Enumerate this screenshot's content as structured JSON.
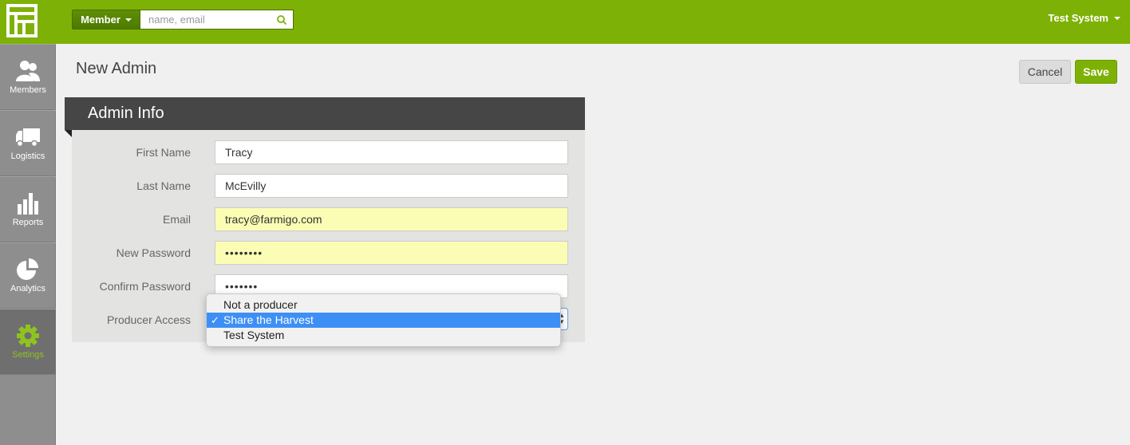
{
  "header": {
    "search_scope": "Member",
    "search_placeholder": "name, email",
    "search_value": "",
    "account_name": "Test System"
  },
  "sidebar": {
    "items": [
      {
        "label": "Members",
        "icon": "members-icon"
      },
      {
        "label": "Logistics",
        "icon": "truck-icon"
      },
      {
        "label": "Reports",
        "icon": "bar-chart-icon"
      },
      {
        "label": "Analytics",
        "icon": "pie-chart-icon"
      },
      {
        "label": "Settings",
        "icon": "gear-icon",
        "active": true
      }
    ]
  },
  "page": {
    "title": "New Admin",
    "cancel_label": "Cancel",
    "save_label": "Save"
  },
  "form": {
    "section_title": "Admin Info",
    "fields": [
      {
        "label": "First Name",
        "value": "Tracy"
      },
      {
        "label": "Last Name",
        "value": "McEvilly"
      },
      {
        "label": "Email",
        "value": "tracy@farmigo.com"
      },
      {
        "label": "New Password",
        "value": "••••••••"
      },
      {
        "label": "Confirm Password",
        "value": "•••••••"
      },
      {
        "label": "Producer Access",
        "value": "Share the Harvest"
      }
    ]
  },
  "dropdown": {
    "options": [
      "Not a producer",
      "Share the Harvest",
      "Test System"
    ],
    "selected_index": 1,
    "check_mark": "✓"
  },
  "colors": {
    "brand_green": "#7eb106",
    "header_dark": "#464646",
    "autofill_yellow": "#fbfdb4",
    "selection_blue": "#3d8ff6"
  }
}
